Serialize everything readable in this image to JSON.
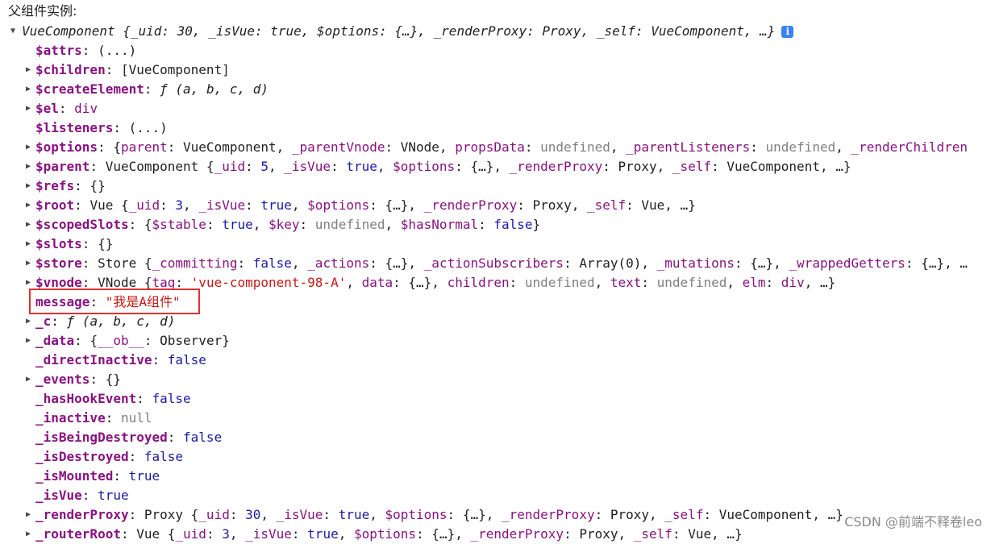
{
  "heading": "父组件实例:",
  "root": {
    "label": "VueComponent {_uid: 30, _isVue: true, $options: {…}, _renderProxy: Proxy, _self: VueComponent, …}",
    "info_icon": "i"
  },
  "props": {
    "attrs": {
      "key": "$attrs",
      "value": "(...)"
    },
    "children": {
      "key": "$children",
      "value": "[VueComponent]"
    },
    "createElement": {
      "key": "$createElement",
      "fn": "ƒ",
      "value": "(a, b, c, d)"
    },
    "el": {
      "key": "$el",
      "value": "div"
    },
    "listeners": {
      "key": "$listeners",
      "value": "(...)"
    },
    "options": {
      "key": "$options",
      "p1": "{",
      "k1": "parent",
      "v1": "VueComponent, ",
      "k2": "_parentVnode",
      "v2": "VNode, ",
      "k3": "propsData",
      "v3": "undefined",
      "s3": ", ",
      "k4": "_parentListeners",
      "v4": "undefined",
      "s4": ", ",
      "k5": "_renderChildren"
    },
    "parent": {
      "key": "$parent",
      "cls": "VueComponent {",
      "k1": "_uid",
      "v1": "5",
      "s1": ", ",
      "k2": "_isVue",
      "v2": "true",
      "s2": ", ",
      "k3": "$options",
      "v3": "{…}, ",
      "k4": "_renderProxy",
      "v4": "Proxy, ",
      "k5": "_self",
      "v5": "VueComponent, …}"
    },
    "refs": {
      "key": "$refs",
      "value": "{}"
    },
    "root": {
      "key": "$root",
      "cls": "Vue {",
      "k1": "_uid",
      "v1": "3",
      "s1": ", ",
      "k2": "_isVue",
      "v2": "true",
      "s2": ", ",
      "k3": "$options",
      "v3": "{…}, ",
      "k4": "_renderProxy",
      "v4": "Proxy, ",
      "k5": "_self",
      "v5": "Vue, …}"
    },
    "scopedSlots": {
      "key": "$scopedSlots",
      "p1": "{",
      "k1": "$stable",
      "v1": "true",
      "s1": ", ",
      "k2": "$key",
      "v2": "undefined",
      "s2": ", ",
      "k3": "$hasNormal",
      "v3": "false",
      "e": "}"
    },
    "slots": {
      "key": "$slots",
      "value": "{}"
    },
    "store": {
      "key": "$store",
      "cls": "Store {",
      "k1": "_committing",
      "v1": "false",
      "s1": ", ",
      "k2": "_actions",
      "v2": "{…}, ",
      "k3": "_actionSubscribers",
      "v3": "Array(0), ",
      "k4": "_mutations",
      "v4": "{…}, ",
      "k5": "_wrappedGetters",
      "v5": "{…}, …"
    },
    "vnode": {
      "key": "$vnode",
      "cls": "VNode {",
      "k1": "tag",
      "v1": "'vue-component-98-A'",
      "s1": ", ",
      "k2": "data",
      "v2": "{…}, ",
      "k3": "children",
      "v3": "undefined",
      "s3": ", ",
      "k4": "text",
      "v4": "undefined",
      "s4": ", ",
      "k5": "elm",
      "v5": "div",
      "e": ", …}"
    },
    "message": {
      "key": "message",
      "value": "\"我是A组件\""
    },
    "c": {
      "key": "_c",
      "fn": "ƒ",
      "value": "(a, b, c, d)"
    },
    "data": {
      "key": "_data",
      "p1": "{",
      "k1": "__ob__",
      "v1": "Observer}"
    },
    "directInactive": {
      "key": "_directInactive",
      "value": "false"
    },
    "events": {
      "key": "_events",
      "value": "{}"
    },
    "hasHookEvent": {
      "key": "_hasHookEvent",
      "value": "false"
    },
    "inactive": {
      "key": "_inactive",
      "value": "null"
    },
    "isBeingDestroyed": {
      "key": "_isBeingDestroyed",
      "value": "false"
    },
    "isDestroyed": {
      "key": "_isDestroyed",
      "value": "false"
    },
    "isMounted": {
      "key": "_isMounted",
      "value": "true"
    },
    "isVue": {
      "key": "_isVue",
      "value": "true"
    },
    "renderProxy": {
      "key": "_renderProxy",
      "cls": "Proxy {",
      "k1": "_uid",
      "v1": "30",
      "s1": ", ",
      "k2": "_isVue",
      "v2": "true",
      "s2": ", ",
      "k3": "$options",
      "v3": "{…}, ",
      "k4": "_renderProxy",
      "v4": "Proxy, ",
      "k5": "_self",
      "v5": "VueComponent, …}"
    },
    "routerRoot": {
      "key": "_routerRoot",
      "cls": "Vue {",
      "k1": "_uid",
      "v1": "3",
      "s1": ", ",
      "k2": "_isVue",
      "v2": "true",
      "s2": ", ",
      "k3": "$options",
      "v3": "{…}, ",
      "k4": "_renderProxy",
      "v4": "Proxy, ",
      "k5": "_self",
      "v5": "Vue, …}"
    }
  },
  "watermark": "CSDN @前端不释卷leo",
  "colors": {
    "key": "#881280",
    "string": "#c41a16",
    "boolean": "#1a1aa6",
    "muted": "#808080",
    "highlight_border": "#e03131",
    "info_icon": "#3b82f6"
  }
}
